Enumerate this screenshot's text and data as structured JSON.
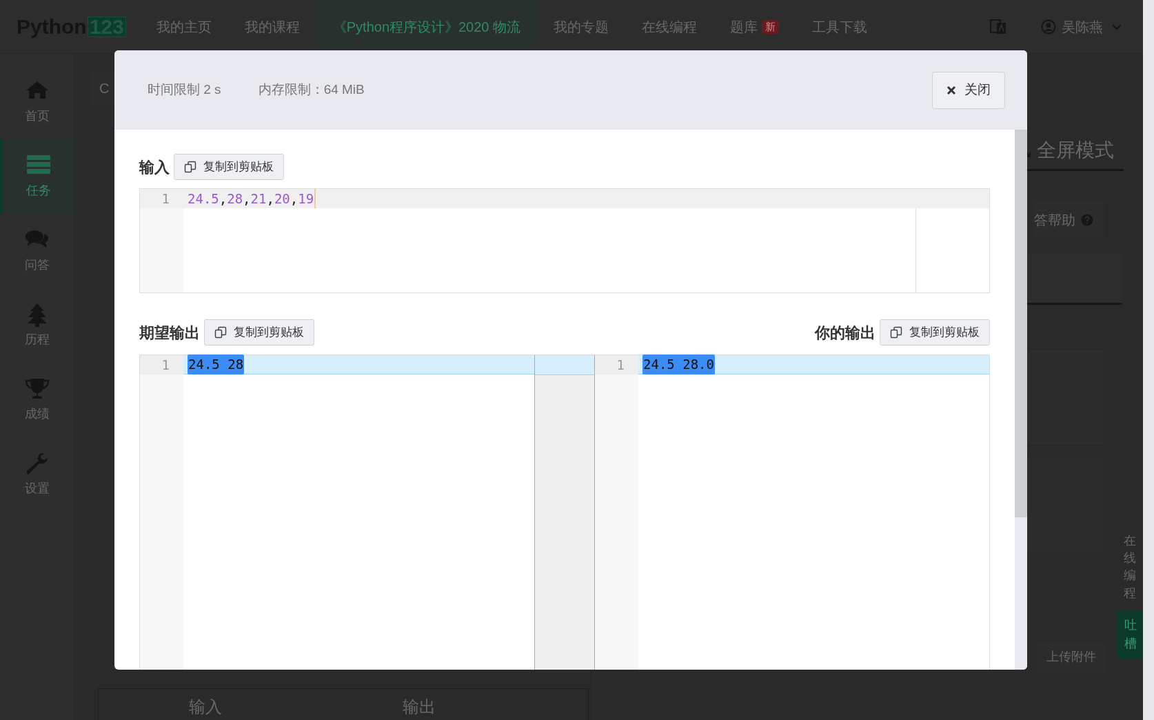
{
  "nav": {
    "logo": {
      "text": "Python",
      "badge": "123"
    },
    "items": [
      {
        "label": "我的主页",
        "selected": false
      },
      {
        "label": "我的课程",
        "selected": false
      },
      {
        "label": "《Python程序设计》2020 物流",
        "selected": true
      },
      {
        "label": "我的专题",
        "selected": false
      },
      {
        "label": "在线编程",
        "selected": false
      },
      {
        "label": "题库",
        "selected": false,
        "badge": "新"
      },
      {
        "label": "工具下载",
        "selected": false
      }
    ],
    "user": "吴陈燕"
  },
  "sidebar": {
    "items": [
      {
        "label": "首页",
        "kind": "home",
        "selected": false
      },
      {
        "label": "任务",
        "kind": "tasks",
        "selected": true
      },
      {
        "label": "问答",
        "kind": "chat",
        "selected": false
      },
      {
        "label": "历程",
        "kind": "tree",
        "selected": false
      },
      {
        "label": "成绩",
        "kind": "trophy",
        "selected": false
      },
      {
        "label": "设置",
        "kind": "wrench",
        "selected": false
      }
    ]
  },
  "background": {
    "card_label": "C",
    "fullscreen_button": "全屏模式",
    "help_button": "答帮助",
    "upload_button": "上传附件",
    "bottom_tabs": [
      "输入",
      "输出"
    ],
    "online_coding": "在线编程",
    "feedback": "吐槽"
  },
  "modal": {
    "time_limit": "时间限制 2 s",
    "memory_limit": "内存限制：64 MiB",
    "close_button": "关闭",
    "input": {
      "title": "输入",
      "copy_button": "复制到剪贴板",
      "lines": [
        {
          "number": "1",
          "tokens": [
            {
              "kind": "number",
              "text": "24.5"
            },
            {
              "kind": "punct",
              "text": ","
            },
            {
              "kind": "number",
              "text": "28"
            },
            {
              "kind": "punct",
              "text": ","
            },
            {
              "kind": "number",
              "text": "21"
            },
            {
              "kind": "punct",
              "text": ","
            },
            {
              "kind": "number",
              "text": "20"
            },
            {
              "kind": "punct",
              "text": ","
            },
            {
              "kind": "number",
              "text": "19"
            }
          ]
        }
      ]
    },
    "expected": {
      "title": "期望输出",
      "copy_button": "复制到剪贴板",
      "lines": [
        {
          "number": "1",
          "text": "24.5 28",
          "changed": true
        }
      ]
    },
    "actual": {
      "title": "你的输出",
      "copy_button": "复制到剪贴板",
      "lines": [
        {
          "number": "1",
          "text": "24.5 28.0",
          "changed": true
        }
      ]
    }
  }
}
